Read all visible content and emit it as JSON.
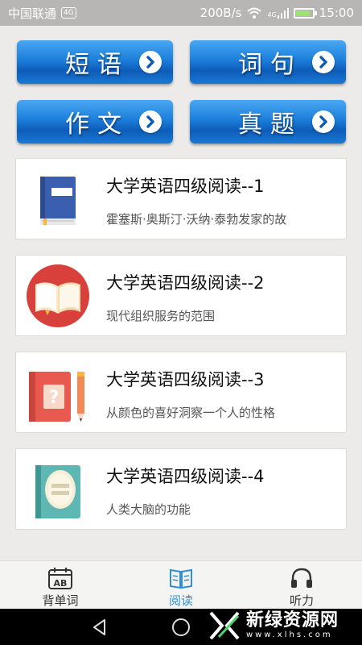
{
  "status_bar": {
    "carrier": "中国联通",
    "sim_badge": "4G",
    "speed": "200B/s",
    "network": "4G",
    "battery_level": 0.85,
    "time": "15:00"
  },
  "categories": [
    {
      "label": "短语",
      "icon": "chevron-right-icon"
    },
    {
      "label": "词句",
      "icon": "chevron-right-icon"
    },
    {
      "label": "作文",
      "icon": "chevron-right-icon"
    },
    {
      "label": "真题",
      "icon": "chevron-right-icon"
    }
  ],
  "articles": [
    {
      "title": "大学英语四级阅读--1",
      "subtitle": "霍塞斯·奥斯汀·沃纳·泰勃发家的故",
      "icon": "blue-book-icon"
    },
    {
      "title": "大学英语四级阅读--2",
      "subtitle": "现代组织服务的范围",
      "icon": "open-book-icon"
    },
    {
      "title": "大学英语四级阅读--3",
      "subtitle": "从颜色的喜好洞察一个人的性格",
      "icon": "question-book-icon"
    },
    {
      "title": "大学英语四级阅读--4",
      "subtitle": "人类大脑的功能",
      "icon": "teal-book-icon"
    }
  ],
  "tabs": [
    {
      "label": "背单词",
      "icon": "calendar-ab-icon",
      "active": false
    },
    {
      "label": "阅读",
      "icon": "open-book-icon",
      "active": true
    },
    {
      "label": "听力",
      "icon": "headphones-icon",
      "active": false
    }
  ],
  "nav_bar": {
    "icons": [
      "back-icon",
      "home-icon",
      "recents-icon"
    ]
  },
  "watermark": {
    "name": "新绿资源网",
    "url": "www.xlhs.com"
  },
  "colors": {
    "accent_blue": "#1c7fdb",
    "active_tab": "#2f8fd8",
    "background": "#ecebea"
  }
}
